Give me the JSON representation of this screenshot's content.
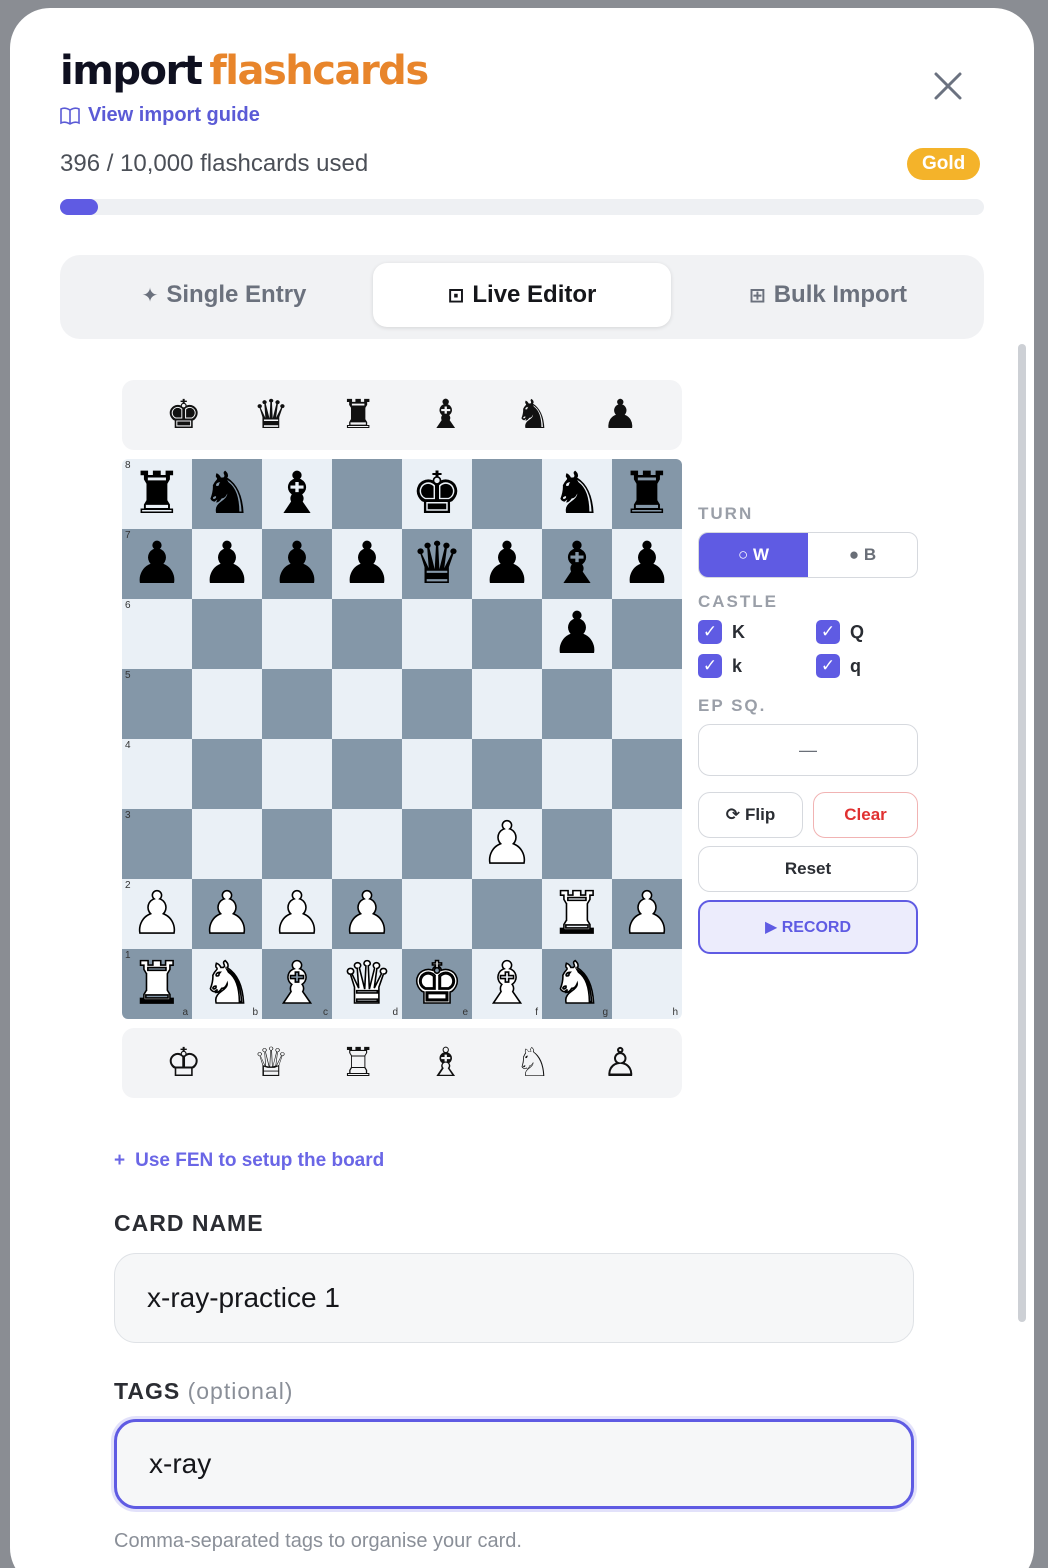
{
  "header": {
    "title_word1": "import",
    "title_word2": "flashcards",
    "guide_label": "View import guide",
    "close_label": "×"
  },
  "usage": {
    "text": "396 / 10,000 flashcards used",
    "used": 396,
    "limit": 10000,
    "tier": "Gold"
  },
  "tabs": [
    {
      "icon": "✦",
      "label": "Single Entry"
    },
    {
      "icon": "⊡",
      "label": "Live Editor"
    },
    {
      "icon": "⊞",
      "label": "Bulk Import"
    }
  ],
  "trays": {
    "black": [
      "♚",
      "♛",
      "♜",
      "♝",
      "♞",
      "♟"
    ],
    "white": [
      "♔",
      "♕",
      "♖",
      "♗",
      "♘",
      "♙"
    ]
  },
  "board": {
    "ranks": [
      "8",
      "7",
      "6",
      "5",
      "4",
      "3",
      "2",
      "1"
    ],
    "files": [
      "a",
      "b",
      "c",
      "d",
      "e",
      "f",
      "g",
      "h"
    ],
    "position": [
      [
        "r",
        "n",
        "b",
        "",
        "k",
        "",
        "n",
        "r"
      ],
      [
        "p",
        "p",
        "p",
        "p",
        "q",
        "p",
        "b",
        "p"
      ],
      [
        "",
        "",
        "",
        "",
        "",
        "",
        "p",
        ""
      ],
      [
        "",
        "",
        "",
        "",
        "",
        "",
        "",
        ""
      ],
      [
        "",
        "",
        "",
        "",
        "",
        "",
        "",
        ""
      ],
      [
        "",
        "",
        "",
        "",
        "",
        "P",
        "",
        ""
      ],
      [
        "P",
        "P",
        "P",
        "P",
        "",
        "",
        "R",
        "P"
      ],
      [
        "R",
        "N",
        "B",
        "Q",
        "K",
        "B",
        "N",
        ""
      ]
    ]
  },
  "controls": {
    "turn_label": "TURN",
    "turn_white": "○ W",
    "turn_black": "● B",
    "castle_label": "CASTLE",
    "castle": [
      {
        "label": "K"
      },
      {
        "label": "Q"
      },
      {
        "label": "k"
      },
      {
        "label": "q"
      }
    ],
    "check_glyph": "✓",
    "ep_label": "EP SQ.",
    "ep_value": "—",
    "flip_label": "Flip",
    "flip_icon": "⟳",
    "clear_label": "Clear",
    "reset_label": "Reset",
    "record_label": "▶ RECORD"
  },
  "fen_link": {
    "icon": "+",
    "label": "Use FEN to setup the board"
  },
  "form": {
    "card_name_label": "CARD NAME",
    "card_name_value": "x-ray-practice 1",
    "tags_label": "TAGS",
    "tags_optional": "(optional)",
    "tags_value": "x-ray",
    "tags_help": "Comma-separated tags to organise your card."
  }
}
